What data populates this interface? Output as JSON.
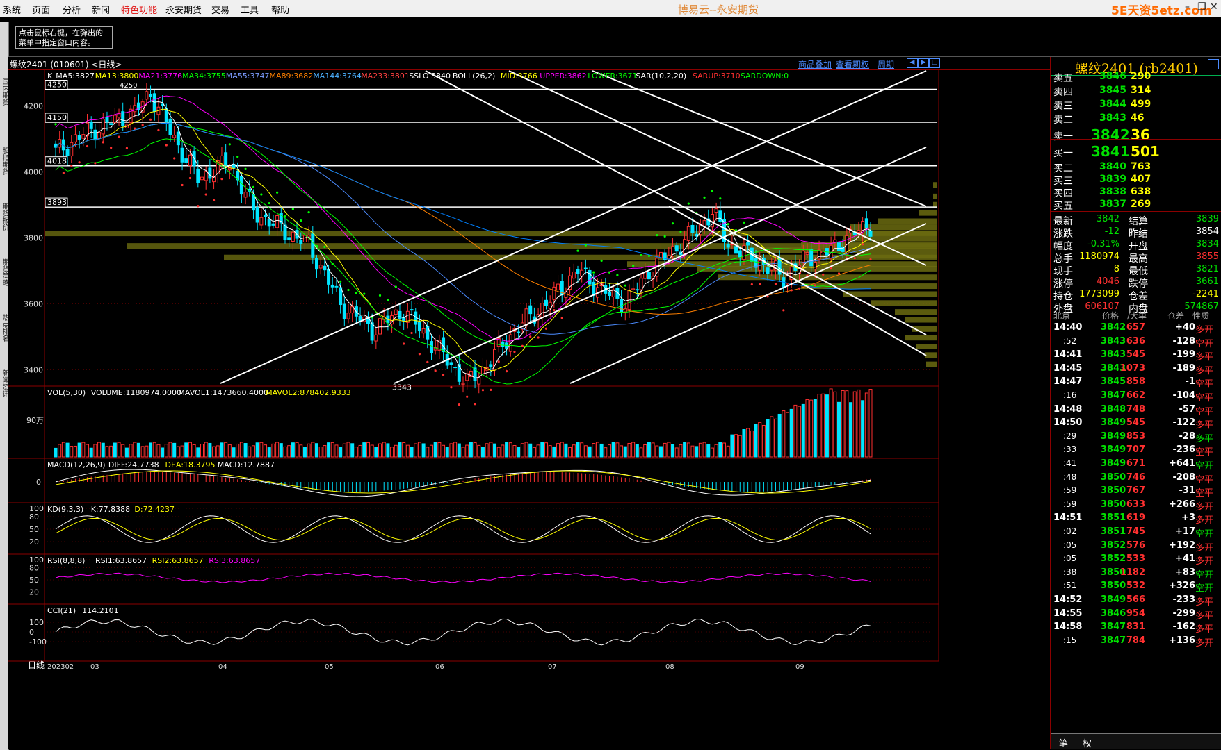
{
  "menubar": {
    "items": [
      "系统",
      "页面",
      "分析",
      "新闻",
      "特色功能",
      "永安期货",
      "交易",
      "工具",
      "帮助"
    ],
    "title": "博易云--永安期货",
    "brand": "5E天资5etz.com"
  },
  "toolbar": {
    "hint_line1": "点击鼠标右键，在弹出的",
    "hint_line2": "菜单中指定窗口内容。"
  },
  "sidetabs": [
    "国内期货",
    "股指期货",
    "期货报价",
    "期货策略",
    "热点排名",
    "新闻资讯"
  ],
  "chart": {
    "header_title": "螺纹2401 (010601) <日线>",
    "links": [
      "商品叠加",
      "查看期权",
      "周期"
    ],
    "colors": {
      "up": "#ff3030",
      "down": "#00e5ff",
      "bg": "#000000",
      "grid": "#8b0000",
      "ma5": "#ffffff",
      "ma13": "#ffff00",
      "ma21": "#ff00ff",
      "ma34": "#00ff00",
      "ma55": "#4c8cff",
      "ma89": "#ff8000",
      "ma144": "#0080ff",
      "ma233": "#ff4040"
    },
    "legend": [
      {
        "text": "K",
        "color": "#ffffff"
      },
      {
        "text": "MA5:3827",
        "color": "#ffffff"
      },
      {
        "text": "MA13:3800",
        "color": "#ffff00"
      },
      {
        "text": "MA21:3776",
        "color": "#ff00ff"
      },
      {
        "text": "MA34:3755",
        "color": "#00ff00"
      },
      {
        "text": "MA55:3747",
        "color": "#7c9cff"
      },
      {
        "text": "MA89:3682",
        "color": "#ff8000"
      },
      {
        "text": "MA144:3764",
        "color": "#4cb0ff"
      },
      {
        "text": "MA233:3801",
        "color": "#ff4040"
      },
      {
        "text": "SSLO 3840",
        "color": "#ffffff"
      },
      {
        "text": "BOLL(26,2)",
        "color": "#ffffff"
      },
      {
        "text": "MID:3766",
        "color": "#ffff00"
      },
      {
        "text": "UPPER:3862",
        "color": "#ff00ff"
      },
      {
        "text": "LOWER:3671",
        "color": "#00ff00"
      },
      {
        "text": "SAR(10,2,20)",
        "color": "#ffffff"
      },
      {
        "text": "SARUP:3710",
        "color": "#ff3030"
      },
      {
        "text": "SARDOWN:0",
        "color": "#00ff00"
      }
    ],
    "price_ticks": [
      "4200",
      "4000",
      "3800",
      "3600",
      "3400"
    ],
    "level_labels": [
      "4250",
      "4150",
      "4018",
      "3893"
    ],
    "peak_label": "4250",
    "trough_label": "3343",
    "vol_legend": [
      {
        "text": "VOL(5,30)",
        "color": "#ffffff"
      },
      {
        "text": "VOLUME:1180974.0000",
        "color": "#ffffff"
      },
      {
        "text": "MAVOL1:1473660.4000",
        "color": "#ffffff"
      },
      {
        "text": "MAVOL2:878402.9333",
        "color": "#ffff00"
      }
    ],
    "vol_tick": "90万",
    "macd_legend": [
      {
        "text": "MACD(12,26,9)",
        "color": "#ffffff"
      },
      {
        "text": "DIFF:24.7738",
        "color": "#ffffff"
      },
      {
        "text": "DEA:18.3795",
        "color": "#ffff00"
      },
      {
        "text": "MACD:12.7887",
        "color": "#ffffff"
      }
    ],
    "macd_tick": "0",
    "kd_legend": [
      {
        "text": "KD(9,3,3)",
        "color": "#ffffff"
      },
      {
        "text": "K:77.8388",
        "color": "#ffffff"
      },
      {
        "text": "D:72.4237",
        "color": "#ffff00"
      }
    ],
    "kd_ticks": [
      "100",
      "80",
      "50",
      "20"
    ],
    "rsi_legend": [
      {
        "text": "RSI(8,8,8)",
        "color": "#ffffff"
      },
      {
        "text": "RSI1:63.8657",
        "color": "#ffffff"
      },
      {
        "text": "RSI2:63.8657",
        "color": "#ffff00"
      },
      {
        "text": "RSI3:63.8657",
        "color": "#ff00ff"
      }
    ],
    "rsi_ticks": [
      "100",
      "80",
      "50",
      "20"
    ],
    "cci_legend": [
      {
        "text": "CCI(21)",
        "color": "#ffffff"
      },
      {
        "text": "114.2101",
        "color": "#ffffff"
      }
    ],
    "cci_ticks": [
      "100",
      "0",
      "-100"
    ],
    "period_label": "日线",
    "date_ticks": [
      "202302",
      "03",
      "04",
      "05",
      "06",
      "07",
      "08",
      "09"
    ]
  },
  "quote": {
    "title": "螺纹2401 (rb2401)",
    "asks": [
      {
        "label": "卖五",
        "price": "3846",
        "vol": "290"
      },
      {
        "label": "卖四",
        "price": "3845",
        "vol": "314"
      },
      {
        "label": "卖三",
        "price": "3844",
        "vol": "499"
      },
      {
        "label": "卖二",
        "price": "3843",
        "vol": "46"
      },
      {
        "label": "卖一",
        "price": "3842",
        "vol": "36"
      }
    ],
    "bids": [
      {
        "label": "买一",
        "price": "3841",
        "vol": "501"
      },
      {
        "label": "买二",
        "price": "3840",
        "vol": "763"
      },
      {
        "label": "买三",
        "price": "3839",
        "vol": "407"
      },
      {
        "label": "买四",
        "price": "3838",
        "vol": "638"
      },
      {
        "label": "买五",
        "price": "3837",
        "vol": "269"
      }
    ],
    "stats": [
      {
        "l1": "最新",
        "v1": "3842",
        "c1": "g",
        "l2": "结算",
        "v2": "3839",
        "c2": "g"
      },
      {
        "l1": "涨跌",
        "v1": "-12",
        "c1": "g",
        "l2": "昨结",
        "v2": "3854",
        "c2": "w"
      },
      {
        "l1": "幅度",
        "v1": "-0.31%",
        "c1": "g",
        "l2": "开盘",
        "v2": "3834",
        "c2": "g"
      },
      {
        "l1": "总手",
        "v1": "1180974",
        "c1": "y",
        "l2": "最高",
        "v2": "3855",
        "c2": "r"
      },
      {
        "l1": "现手",
        "v1": "8",
        "c1": "y",
        "l2": "最低",
        "v2": "3821",
        "c2": "g"
      },
      {
        "l1": "涨停",
        "v1": "4046",
        "c1": "r",
        "l2": "跌停",
        "v2": "3661",
        "c2": "g"
      },
      {
        "l1": "持仓",
        "v1": "1773099",
        "c1": "y",
        "l2": "仓差",
        "v2": "-2241",
        "c2": "y"
      },
      {
        "l1": "外盘",
        "v1": "606107",
        "c1": "r",
        "l2": "内盘",
        "v2": "574867",
        "c2": "g"
      }
    ],
    "tick_header": [
      "北京",
      "价格",
      "∕大单",
      "仓差",
      "性质"
    ],
    "ticks": [
      {
        "t": "14:40",
        "sub": false,
        "p": "3842",
        "v": "657",
        "d": "+40",
        "n": "多开",
        "nc": "r"
      },
      {
        "t": ":52",
        "sub": true,
        "p": "3843",
        "v": "636",
        "d": "-128",
        "n": "空开",
        "nc": "r"
      },
      {
        "t": "14:41",
        "sub": false,
        "p": "3843",
        "v": "545",
        "d": "-199",
        "n": "多平",
        "nc": "r"
      },
      {
        "t": "14:45",
        "sub": false,
        "p": "3843",
        "v": "1073",
        "d": "-189",
        "n": "多平",
        "nc": "r"
      },
      {
        "t": "14:47",
        "sub": false,
        "p": "3845",
        "v": "858",
        "d": "-1",
        "n": "空平",
        "nc": "r"
      },
      {
        "t": ":16",
        "sub": true,
        "p": "3847",
        "v": "662",
        "d": "-104",
        "n": "空平",
        "nc": "r"
      },
      {
        "t": "14:48",
        "sub": false,
        "p": "3848",
        "v": "748",
        "d": "-57",
        "n": "空平",
        "nc": "r"
      },
      {
        "t": "14:50",
        "sub": false,
        "p": "3849",
        "v": "545",
        "d": "-122",
        "n": "多平",
        "nc": "r"
      },
      {
        "t": ":29",
        "sub": true,
        "p": "3849",
        "v": "853",
        "d": "-28",
        "n": "多平",
        "nc": "g"
      },
      {
        "t": ":33",
        "sub": true,
        "p": "3849",
        "v": "707",
        "d": "-236",
        "n": "空平",
        "nc": "r"
      },
      {
        "t": ":41",
        "sub": true,
        "p": "3849",
        "v": "671",
        "d": "+641",
        "n": "空开",
        "nc": "g"
      },
      {
        "t": ":48",
        "sub": true,
        "p": "3850",
        "v": "746",
        "d": "-208",
        "n": "空平",
        "nc": "r"
      },
      {
        "t": ":59",
        "sub": true,
        "p": "3850",
        "v": "767",
        "d": "-31",
        "n": "空平",
        "nc": "r"
      },
      {
        "t": ":59",
        "sub": true,
        "p": "3850",
        "v": "633",
        "d": "+266",
        "n": "多开",
        "nc": "r"
      },
      {
        "t": "14:51",
        "sub": false,
        "p": "3851",
        "v": "619",
        "d": "+3",
        "n": "多开",
        "nc": "r"
      },
      {
        "t": ":02",
        "sub": true,
        "p": "3851",
        "v": "745",
        "d": "+17",
        "n": "空开",
        "nc": "g"
      },
      {
        "t": ":05",
        "sub": true,
        "p": "3852",
        "v": "576",
        "d": "+192",
        "n": "多开",
        "nc": "r"
      },
      {
        "t": ":05",
        "sub": true,
        "p": "3852",
        "v": "533",
        "d": "+41",
        "n": "多开",
        "nc": "r"
      },
      {
        "t": ":38",
        "sub": true,
        "p": "3850",
        "v": "1182",
        "d": "+83",
        "n": "空开",
        "nc": "g"
      },
      {
        "t": ":51",
        "sub": true,
        "p": "3850",
        "v": "532",
        "d": "+326",
        "n": "空开",
        "nc": "g"
      },
      {
        "t": "14:52",
        "sub": false,
        "p": "3849",
        "v": "566",
        "d": "-233",
        "n": "多平",
        "nc": "r"
      },
      {
        "t": "14:55",
        "sub": false,
        "p": "3846",
        "v": "954",
        "d": "-299",
        "n": "多平",
        "nc": "r"
      },
      {
        "t": "14:58",
        "sub": false,
        "p": "3847",
        "v": "831",
        "d": "-162",
        "n": "多平",
        "nc": "r"
      },
      {
        "t": ":15",
        "sub": true,
        "p": "3847",
        "v": "784",
        "d": "+136",
        "n": "多开",
        "nc": "r"
      }
    ],
    "bottom_tabs": [
      "笔",
      "权"
    ]
  }
}
